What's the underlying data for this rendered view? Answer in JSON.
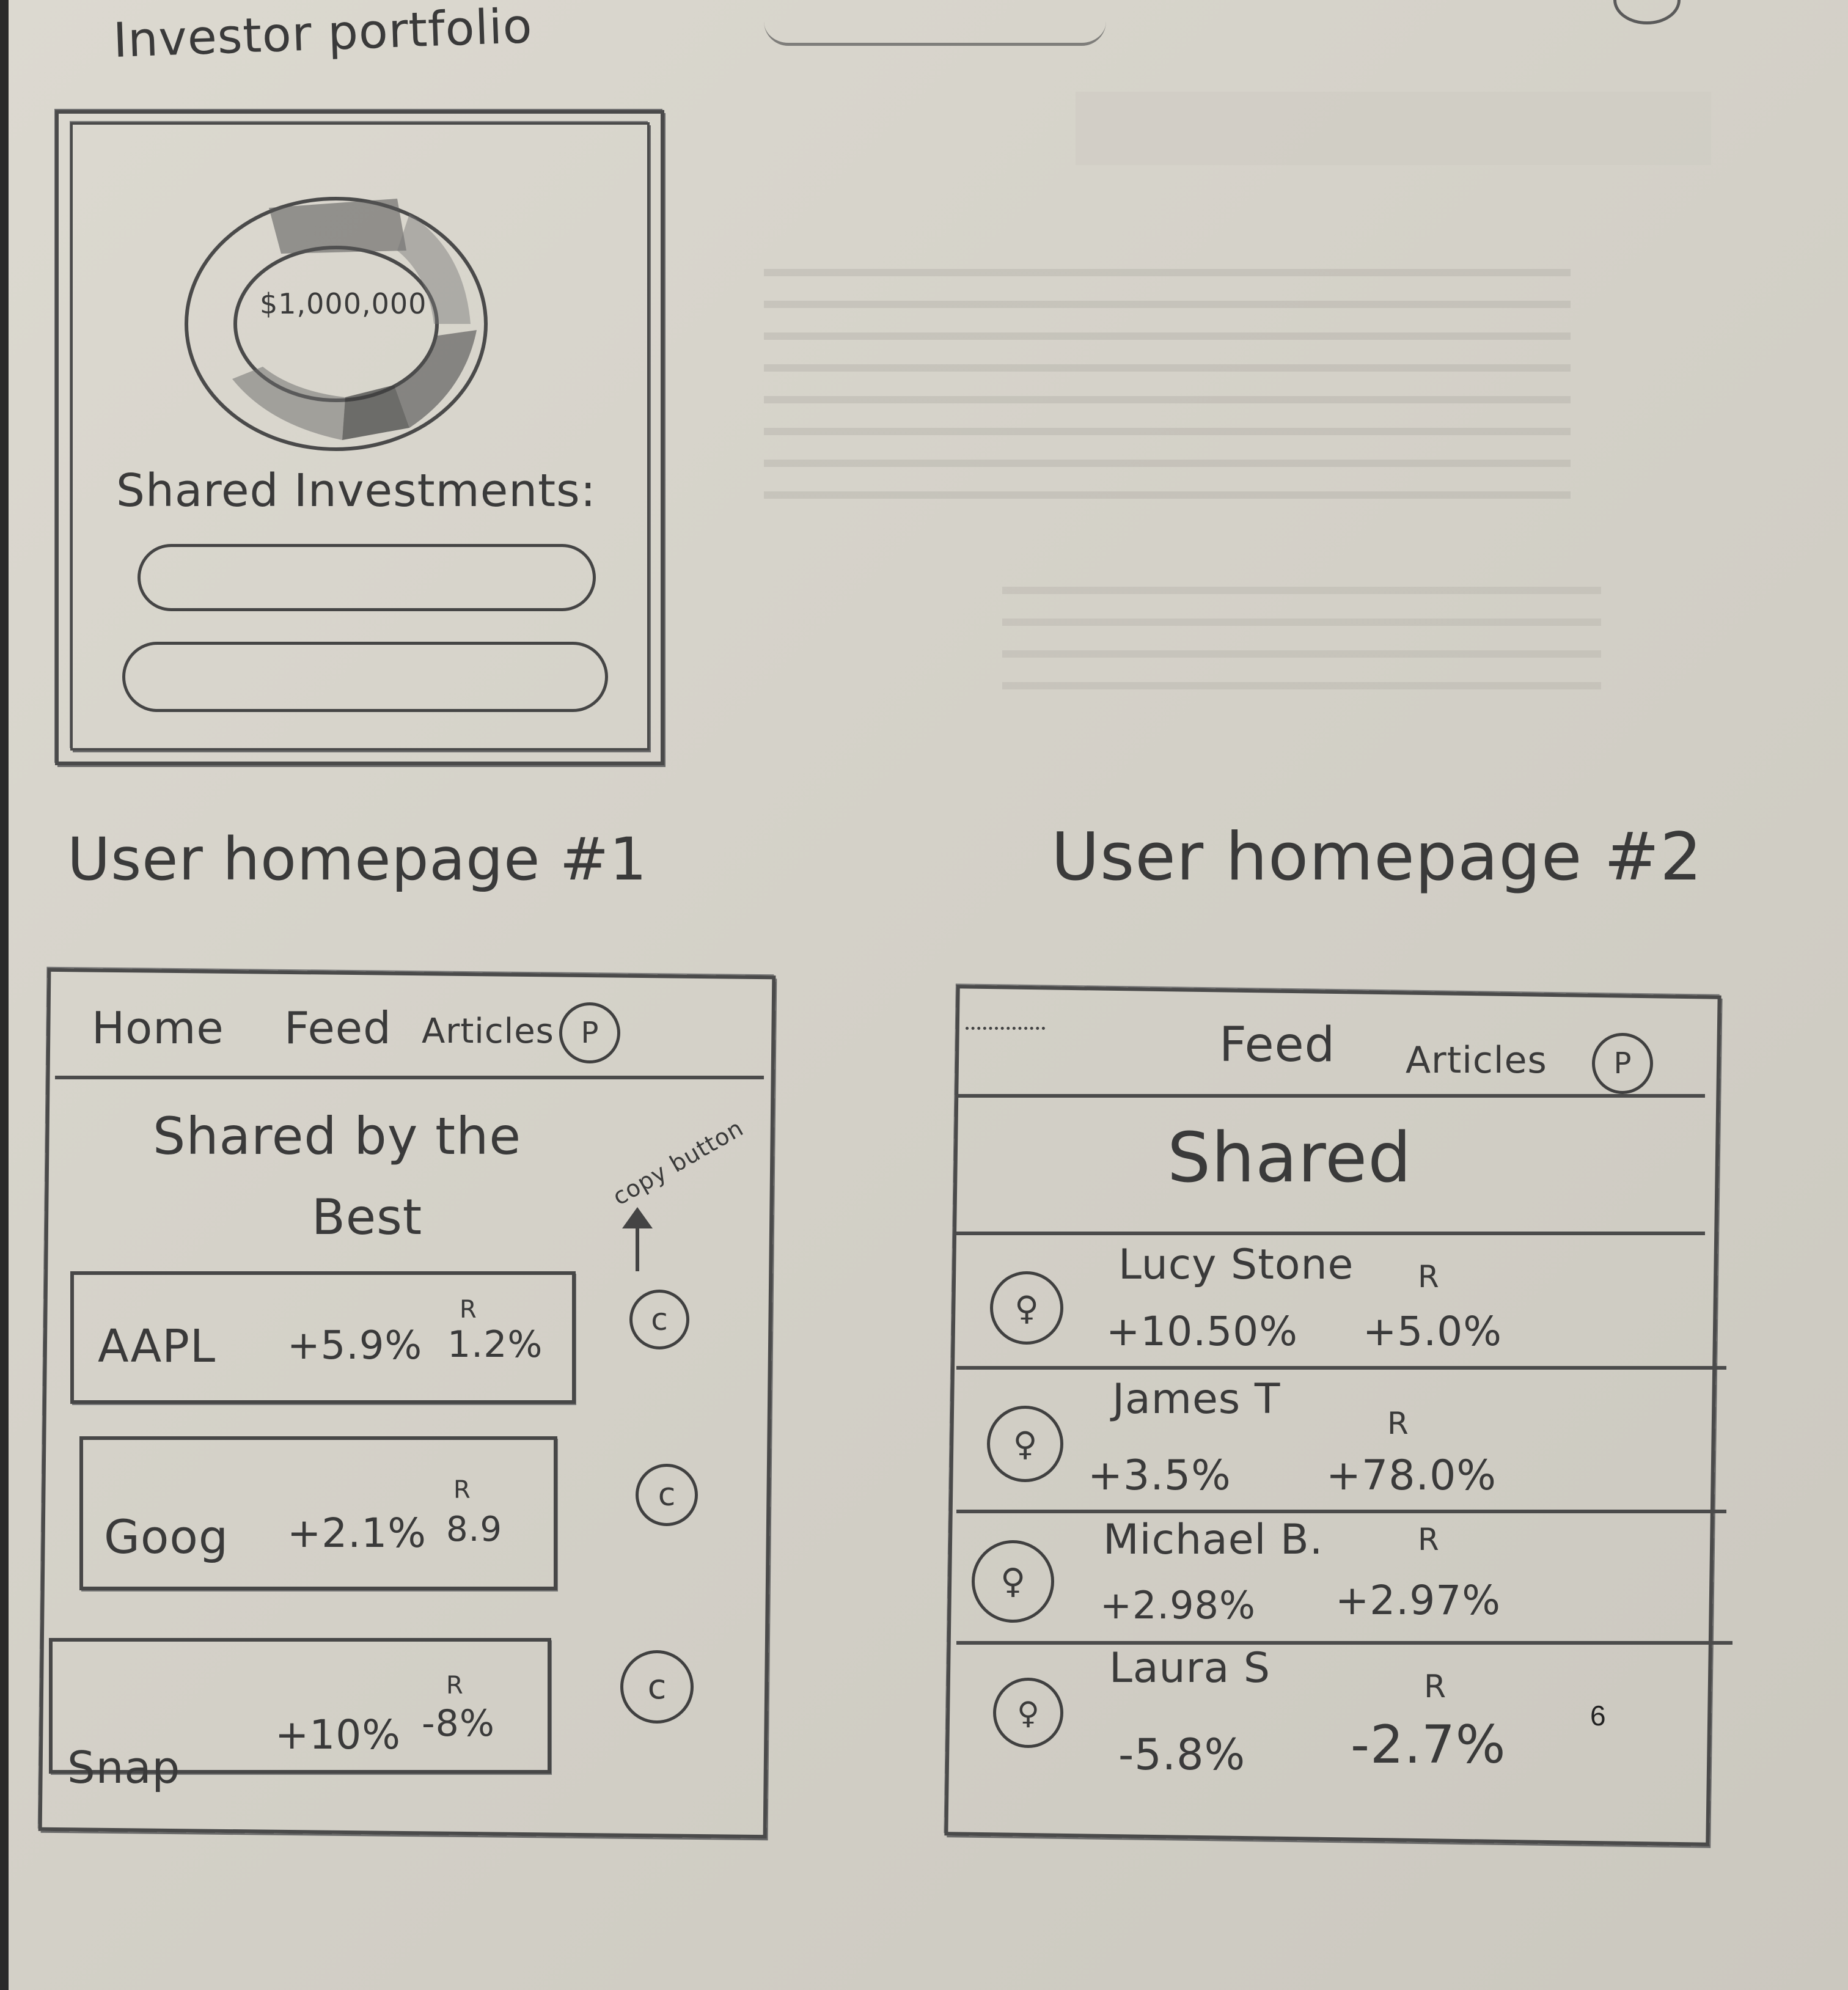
{
  "portfolio": {
    "title": "Investor portfolio",
    "total_value": "$1,000,000",
    "shared_label": "Shared Investments:"
  },
  "homepage1": {
    "heading": "User homepage #1",
    "nav": {
      "home": "Home",
      "feed": "Feed",
      "articles": "Articles",
      "profile": "P"
    },
    "section_title_line1": "Shared by the",
    "section_title_line2": "Best",
    "copy_annotation": "copy button",
    "copy_label": "c",
    "rows": [
      {
        "ticker": "AAPL",
        "change": "+5.9%",
        "r_label": "R",
        "r_value": "1.2%"
      },
      {
        "ticker": "Goog",
        "change": "+2.1%",
        "r_label": "R",
        "r_value": "8.9"
      },
      {
        "ticker": "Snap",
        "change": "+10%",
        "r_label": "R",
        "r_value": "-8%"
      }
    ]
  },
  "homepage2": {
    "heading": "User homepage #2",
    "nav": {
      "feed": "Feed",
      "articles": "Articles",
      "profile": "P"
    },
    "section_title": "Shared",
    "users": [
      {
        "name": "Lucy Stone",
        "change": "+10.50%",
        "r_label": "R",
        "r_value": "+5.0%"
      },
      {
        "name": "James T",
        "change": "+3.5%",
        "r_label": "R",
        "r_value": "+78.0%"
      },
      {
        "name": "Michael B.",
        "change": "+2.98%",
        "r_label": "R",
        "r_value": "+2.97%"
      },
      {
        "name": "Laura S",
        "change": "-5.8%",
        "r_label": "R",
        "r_value": "-2.7%"
      }
    ]
  },
  "page_number": "6"
}
